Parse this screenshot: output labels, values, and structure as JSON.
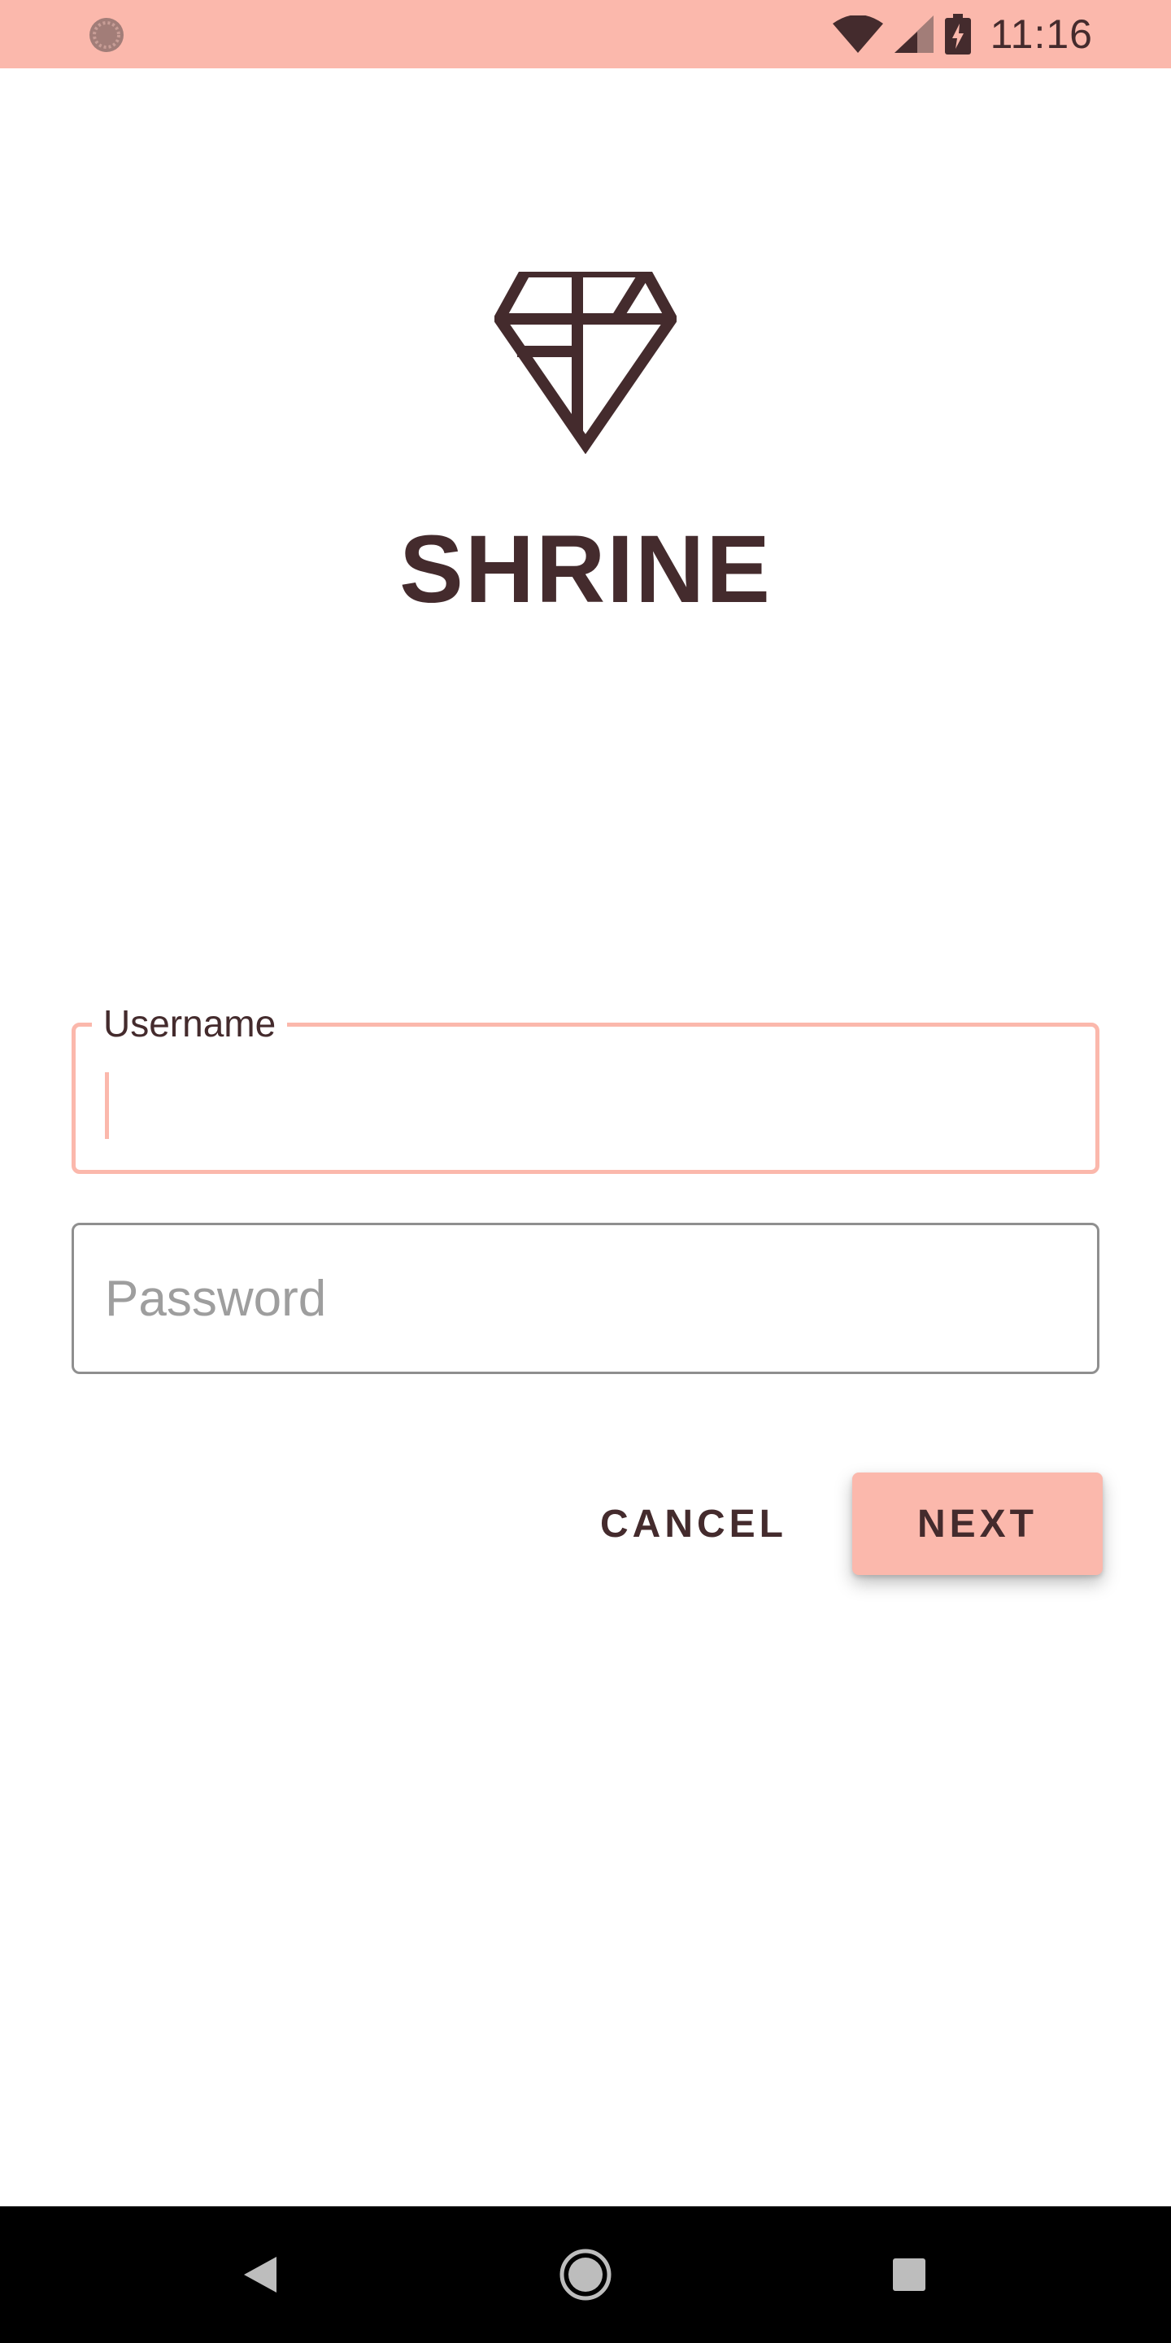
{
  "status_bar": {
    "time": "11:16",
    "background_color": "#fbb8ac",
    "left_icon": "sync-icon",
    "right_icons": [
      "wifi-icon",
      "signal-icon",
      "battery-charging-icon"
    ]
  },
  "brand": {
    "logo_icon": "diamond-icon",
    "title": "SHRINE",
    "text_color": "#442b2d"
  },
  "form": {
    "username": {
      "label": "Username",
      "value": "",
      "focused": true
    },
    "password": {
      "placeholder": "Password",
      "value": ""
    }
  },
  "actions": {
    "cancel_label": "CANCEL",
    "next_label": "NEXT",
    "accent_color": "#fbb8ac"
  },
  "nav_bar": {
    "buttons": [
      "back-icon",
      "home-icon",
      "recents-icon"
    ]
  }
}
